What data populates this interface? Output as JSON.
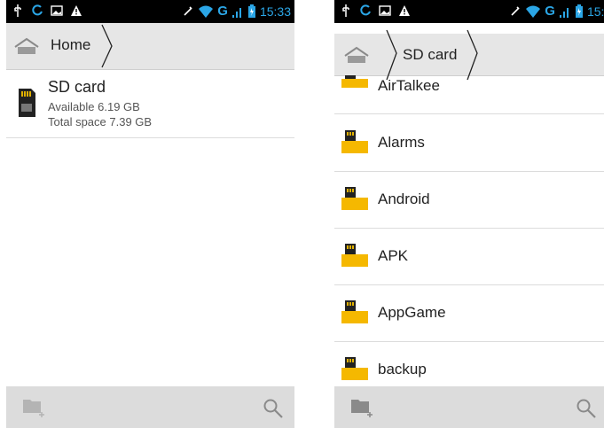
{
  "status_bar": {
    "time": "15:33",
    "network": "G",
    "icons_left": [
      "usb-icon",
      "sync-icon",
      "image-icon",
      "warning-icon"
    ],
    "icons_right": [
      "mute-icon",
      "wifi-icon",
      "signal-icon",
      "battery-icon"
    ],
    "accent_color": "#2ba6e6"
  },
  "left_screen": {
    "breadcrumb": {
      "home_label": "Home"
    },
    "storage": {
      "name": "SD card",
      "available": "Available 6.19 GB",
      "total": "Total space 7.39 GB"
    }
  },
  "right_screen": {
    "breadcrumb": {
      "current": "SD card"
    },
    "folders": [
      "AirTalkee",
      "Alarms",
      "Android",
      "APK",
      "AppGame",
      "backup"
    ]
  },
  "bottom_bar": {
    "icons": [
      "new-folder-icon",
      "search-icon"
    ]
  }
}
